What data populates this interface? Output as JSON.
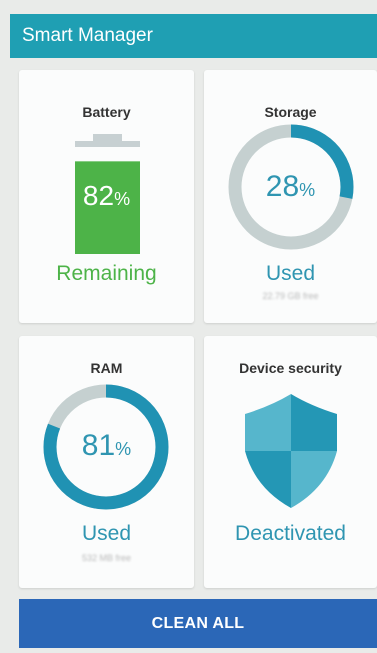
{
  "app_title": "Smart Manager",
  "colors": {
    "accent": "#1f9fb3",
    "battery_green": "#4db348",
    "ring_blue": "#2092b3",
    "ring_gray": "#c5d0d0",
    "button_blue": "#2b67b7"
  },
  "battery": {
    "title": "Battery",
    "percent": "82",
    "percent_sign": "%",
    "status": "Remaining",
    "level": 0.82
  },
  "storage": {
    "title": "Storage",
    "percent": "28",
    "percent_sign": "%",
    "status": "Used",
    "detail": "22.79 GB free",
    "used_fraction": 0.28
  },
  "ram": {
    "title": "RAM",
    "percent": "81",
    "percent_sign": "%",
    "status": "Used",
    "detail": "532 MB free",
    "used_fraction": 0.81
  },
  "device_security": {
    "title": "Device security",
    "status": "Deactivated",
    "icon": "shield-icon"
  },
  "clean_all_label": "CLEAN ALL"
}
